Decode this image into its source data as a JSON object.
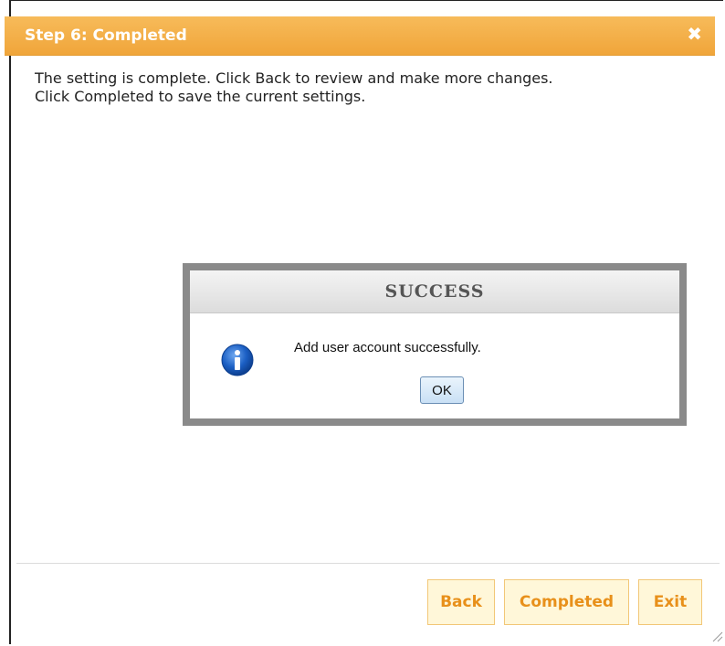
{
  "dialog": {
    "title": "Step 6: Completed",
    "close_glyph": "✖",
    "description_line1": "The setting is complete. Click Back to review and make more changes.",
    "description_line2": "Click Completed to save the current settings."
  },
  "footer": {
    "back_label": "Back",
    "completed_label": "Completed",
    "exit_label": "Exit"
  },
  "modal": {
    "title": "SUCCESS",
    "message": "Add user account successfully.",
    "ok_label": "OK",
    "icon": "info-icon"
  },
  "colors": {
    "titlebar": "#f0a53a",
    "button_text": "#e8901a",
    "button_bg": "#fff7d9",
    "modal_border": "#8a8a8a",
    "info_blue": "#1b5fc4"
  }
}
